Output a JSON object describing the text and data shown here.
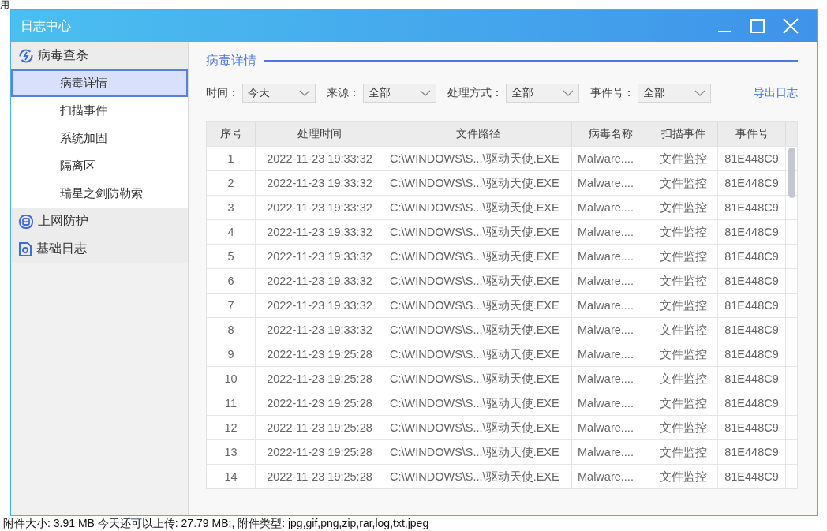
{
  "background": {
    "top_text": "用",
    "bottom_text": "附件大小: 3.91 MB  今天还可以上传: 27.79 MB;,  附件类型: jpg,gif,png,zip,rar,log,txt,jpeg"
  },
  "window": {
    "title": "日志中心"
  },
  "sidebar": {
    "groups": [
      {
        "label": "病毒查杀",
        "children": [
          {
            "label": "病毒详情",
            "selected": true
          },
          {
            "label": "扫描事件",
            "selected": false
          },
          {
            "label": "系统加固",
            "selected": false
          },
          {
            "label": "隔离区",
            "selected": false
          },
          {
            "label": "瑞星之剑防勒索",
            "selected": false
          }
        ]
      },
      {
        "label": "上网防护"
      },
      {
        "label": "基础日志"
      }
    ]
  },
  "section_title": "病毒详情",
  "filters": [
    {
      "label": "时间：",
      "value": "今天"
    },
    {
      "label": "来源：",
      "value": "全部"
    },
    {
      "label": "处理方式：",
      "value": "全部"
    },
    {
      "label": "事件号：",
      "value": "全部"
    }
  ],
  "export_link": "导出日志",
  "table": {
    "columns": [
      "序号",
      "处理时间",
      "文件路径",
      "病毒名称",
      "扫描事件",
      "事件号"
    ],
    "rows": [
      [
        "1",
        "2022-11-23 19:33:32",
        "C:\\WINDOWS\\S...\\驱动天使.EXE",
        "Malware....",
        "文件监控",
        "81E448C9"
      ],
      [
        "2",
        "2022-11-23 19:33:32",
        "C:\\WINDOWS\\S...\\驱动天使.EXE",
        "Malware....",
        "文件监控",
        "81E448C9"
      ],
      [
        "3",
        "2022-11-23 19:33:32",
        "C:\\WINDOWS\\S...\\驱动天使.EXE",
        "Malware....",
        "文件监控",
        "81E448C9"
      ],
      [
        "4",
        "2022-11-23 19:33:32",
        "C:\\WINDOWS\\S...\\驱动天使.EXE",
        "Malware....",
        "文件监控",
        "81E448C9"
      ],
      [
        "5",
        "2022-11-23 19:33:32",
        "C:\\WINDOWS\\S...\\驱动天使.EXE",
        "Malware....",
        "文件监控",
        "81E448C9"
      ],
      [
        "6",
        "2022-11-23 19:33:32",
        "C:\\WINDOWS\\S...\\驱动天使.EXE",
        "Malware....",
        "文件监控",
        "81E448C9"
      ],
      [
        "7",
        "2022-11-23 19:33:32",
        "C:\\WINDOWS\\S...\\驱动天使.EXE",
        "Malware....",
        "文件监控",
        "81E448C9"
      ],
      [
        "8",
        "2022-11-23 19:33:32",
        "C:\\WINDOWS\\S...\\驱动天使.EXE",
        "Malware....",
        "文件监控",
        "81E448C9"
      ],
      [
        "9",
        "2022-11-23 19:25:28",
        "C:\\WINDOWS\\S...\\驱动天使.EXE",
        "Malware....",
        "文件监控",
        "81E448C9"
      ],
      [
        "10",
        "2022-11-23 19:25:28",
        "C:\\WINDOWS\\S...\\驱动天使.EXE",
        "Malware....",
        "文件监控",
        "81E448C9"
      ],
      [
        "11",
        "2022-11-23 19:25:28",
        "C:\\WINDOWS\\S...\\驱动天使.EXE",
        "Malware....",
        "文件监控",
        "81E448C9"
      ],
      [
        "12",
        "2022-11-23 19:25:28",
        "C:\\WINDOWS\\S...\\驱动天使.EXE",
        "Malware....",
        "文件监控",
        "81E448C9"
      ],
      [
        "13",
        "2022-11-23 19:25:28",
        "C:\\WINDOWS\\S...\\驱动天使.EXE",
        "Malware....",
        "文件监控",
        "81E448C9"
      ],
      [
        "14",
        "2022-11-23 19:25:28",
        "C:\\WINDOWS\\S...\\驱动天使.EXE",
        "Malware....",
        "文件监控",
        "81E448C9"
      ]
    ]
  }
}
